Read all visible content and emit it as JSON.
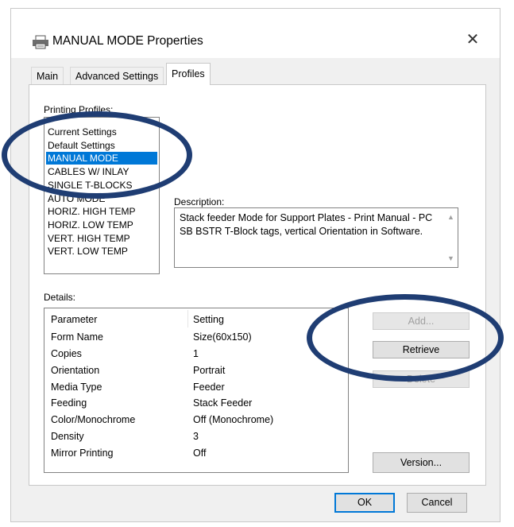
{
  "window": {
    "title": "MANUAL MODE Properties"
  },
  "tabs": [
    {
      "label": "Main"
    },
    {
      "label": "Advanced Settings"
    },
    {
      "label": "Profiles"
    }
  ],
  "profiles": {
    "group_label": "Printing Profiles:",
    "items": [
      "Current Settings",
      "Default Settings",
      "MANUAL MODE",
      "CABLES W/ INLAY",
      "SINGLE T-BLOCKS",
      "AUTO MODE",
      "HORIZ. HIGH TEMP",
      "HORIZ. LOW TEMP",
      "VERT. HIGH TEMP",
      "VERT. LOW TEMP"
    ],
    "selected": "MANUAL MODE"
  },
  "description": {
    "label": "Description:",
    "text": "Stack feeder Mode for Support Plates - Print Manual - PC SB BSTR T-Block tags, vertical Orientation in Software."
  },
  "details": {
    "label": "Details:",
    "columns": [
      "Parameter",
      "Setting"
    ],
    "rows": [
      [
        "Form Name",
        "Size(60x150)"
      ],
      [
        "Copies",
        "1"
      ],
      [
        "Orientation",
        "Portrait"
      ],
      [
        "Media Type",
        "Feeder"
      ],
      [
        "Feeding",
        "Stack Feeder"
      ],
      [
        "Color/Monochrome",
        "Off (Monochrome)"
      ],
      [
        "Density",
        "3"
      ],
      [
        "Mirror Printing",
        "Off"
      ]
    ]
  },
  "buttons": {
    "add": "Add...",
    "retrieve": "Retrieve",
    "delete": "Delete",
    "version": "Version...",
    "ok": "OK",
    "cancel": "Cancel"
  },
  "colors": {
    "selection": "#0078d7",
    "annotation_ellipse": "#1f3d73"
  }
}
